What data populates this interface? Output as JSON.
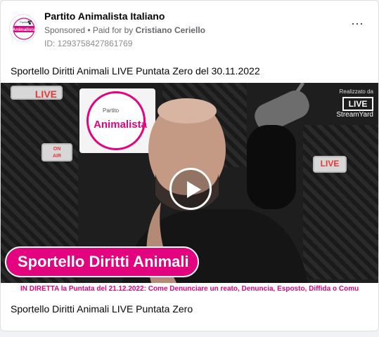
{
  "post": {
    "page_name": "Partito Animalista Italiano",
    "sponsored": "Sponsored",
    "paid_by_prefix": " • Paid for by ",
    "paid_by_name": "Cristiano Ceriello",
    "ad_id": "ID: 1293758427861769",
    "more_icon": "⋯",
    "caption_top": "Sportello Diritti Animali LIVE Puntata Zero del 30.11.2022",
    "caption_bottom": "Sportello Diritti Animali LIVE Puntata Zero"
  },
  "avatar": {
    "top_text": "Partito",
    "name": "Animalista",
    "icon": "paw-logo"
  },
  "video": {
    "live_sign_1": "LIVE",
    "on_air_top": "ON",
    "on_air_bottom": "AIR",
    "live_sign_2": "LIVE",
    "poster_sub": "Partito",
    "poster_name": "Animalista",
    "brand_small": "Realizzato da",
    "brand_live": "LIVE",
    "brand_yard": "StreamYard",
    "title_pill": "Sportello Diritti Animali",
    "ticker": "IN DIRETTA la Puntata del 21.12.2022: Come Denunciare un reato, Denuncia, Esposto, Diffida o Comu"
  },
  "colors": {
    "brand_pink": "#e4037e",
    "ticker_bg": "#ffffff",
    "muted_text": "#65676b"
  }
}
